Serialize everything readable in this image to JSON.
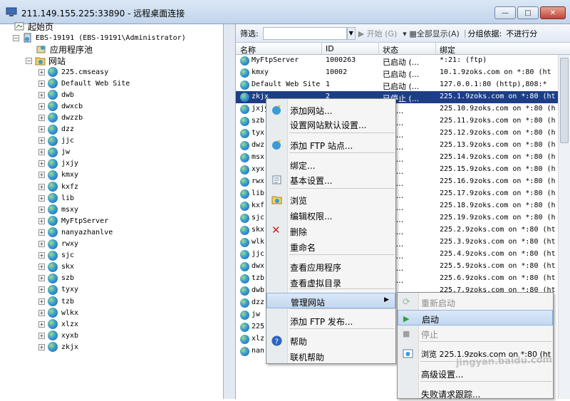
{
  "window": {
    "title": "211.149.155.225:33890 - 远程桌面连接",
    "min": "—",
    "max": "□",
    "close": "✕"
  },
  "tree": {
    "home": "起始页",
    "server": "EBS-19191 (EBS-19191\\Administrator)",
    "apppools": "应用程序池",
    "sites": "网站",
    "items": [
      "225.cmseasy",
      "Default Web Site",
      "dwb",
      "dwxcb",
      "dwzzb",
      "dzz",
      "jjc",
      "jw",
      "jxjy",
      "kmxy",
      "kxfz",
      "lib",
      "msxy",
      "MyFtpServer",
      "nanyazhanlve",
      "rwxy",
      "sjc",
      "skx",
      "szb",
      "tyxy",
      "tzb",
      "wlkx",
      "xlzx",
      "xyxb",
      "zkjx"
    ]
  },
  "toolbar": {
    "filter_label": "筛选:",
    "start": "开始 (G)",
    "showall": "全部显示(A)",
    "groupby": "分组依据:",
    "groupby_value": "不进行分"
  },
  "columns": [
    "名称",
    "ID",
    "状态",
    "绑定"
  ],
  "rows": [
    {
      "name": "MyFtpServer",
      "id": "1000263",
      "status": "已启动 (...",
      "binding": "*:21: (ftp)"
    },
    {
      "name": "kmxy",
      "id": "10002",
      "status": "已启动 (...",
      "binding": "10.1.9zoks.com on *:80 (ht"
    },
    {
      "name": "Default Web Site",
      "id": "1",
      "status": "已启动 (...",
      "binding": "127.0.0.1:80 (http),808:*"
    },
    {
      "name": "zkjx",
      "id": "2",
      "status": "已停止 (...",
      "binding": "225.1.9zoks.com on *:80 (ht"
    },
    {
      "name": "jxjy",
      "id": "",
      "status": "动 (...",
      "binding": "225.10.9zoks.com on *:80 (h"
    },
    {
      "name": "szb",
      "id": "",
      "status": "动 (...",
      "binding": "225.11.9zoks.com on *:80 (h"
    },
    {
      "name": "tyx",
      "id": "",
      "status": "动 (...",
      "binding": "225.12.9zoks.com on *:80 (h"
    },
    {
      "name": "dwz",
      "id": "",
      "status": "动 (...",
      "binding": "225.13.9zoks.com on *:80 (h"
    },
    {
      "name": "msx",
      "id": "",
      "status": "动 (...",
      "binding": "225.14.9zoks.com on *:80 (h"
    },
    {
      "name": "xyx",
      "id": "",
      "status": "动 (...",
      "binding": "225.15.9zoks.com on *:80 (h"
    },
    {
      "name": "rwx",
      "id": "",
      "status": "动 (...",
      "binding": "225.16.9zoks.com on *:80 (h"
    },
    {
      "name": "lib",
      "id": "",
      "status": "动 (...",
      "binding": "225.17.9zoks.com on *:80 (h"
    },
    {
      "name": "kxf",
      "id": "",
      "status": "动 (...",
      "binding": "225.18.9zoks.com on *:80 (h"
    },
    {
      "name": "sjc",
      "id": "",
      "status": "动 (...",
      "binding": "225.19.9zoks.com on *:80 (h"
    },
    {
      "name": "skx",
      "id": "",
      "status": "动 (...",
      "binding": "225.2.9zoks.com on *:80 (ht"
    },
    {
      "name": "wlk",
      "id": "",
      "status": "动 (...",
      "binding": "225.3.9zoks.com on *:80 (ht"
    },
    {
      "name": "jjc",
      "id": "",
      "status": "动 (...",
      "binding": "225.4.9zoks.com on *:80 (ht"
    },
    {
      "name": "dwx",
      "id": "",
      "status": "动 (...",
      "binding": "225.5.9zoks.com on *:80 (ht"
    },
    {
      "name": "tzb",
      "id": "",
      "status": "动 (...",
      "binding": "225.6.9zoks.com on *:80 (ht"
    },
    {
      "name": "dwb",
      "id": "",
      "status": "动 (...",
      "binding": "225.7.9zoks.com on *:80 (ht"
    },
    {
      "name": "dzz",
      "id": "",
      "status": "",
      "binding": ""
    },
    {
      "name": "jw",
      "id": "",
      "status": "",
      "binding": ""
    },
    {
      "name": "225",
      "id": "",
      "status": "",
      "binding": ""
    },
    {
      "name": "xlz",
      "id": "",
      "status": "",
      "binding": ""
    },
    {
      "name": "nan",
      "id": "",
      "status": "",
      "binding": ""
    }
  ],
  "context_menu": [
    "添加网站...",
    "设置网站默认设置...",
    "添加 FTP 站点...",
    "绑定...",
    "基本设置...",
    "浏览",
    "编辑权限...",
    "删除",
    "重命名",
    "查看应用程序",
    "查看虚拟目录",
    "管理网站",
    "添加 FTP 发布...",
    "帮助",
    "联机帮助"
  ],
  "submenu": [
    "重新启动",
    "启动",
    "停止",
    "浏览 225.1.9zoks.com on *:80 (ht",
    "高级设置...",
    "失败请求跟踪..."
  ],
  "watermark": "jingyan.baidu.com"
}
